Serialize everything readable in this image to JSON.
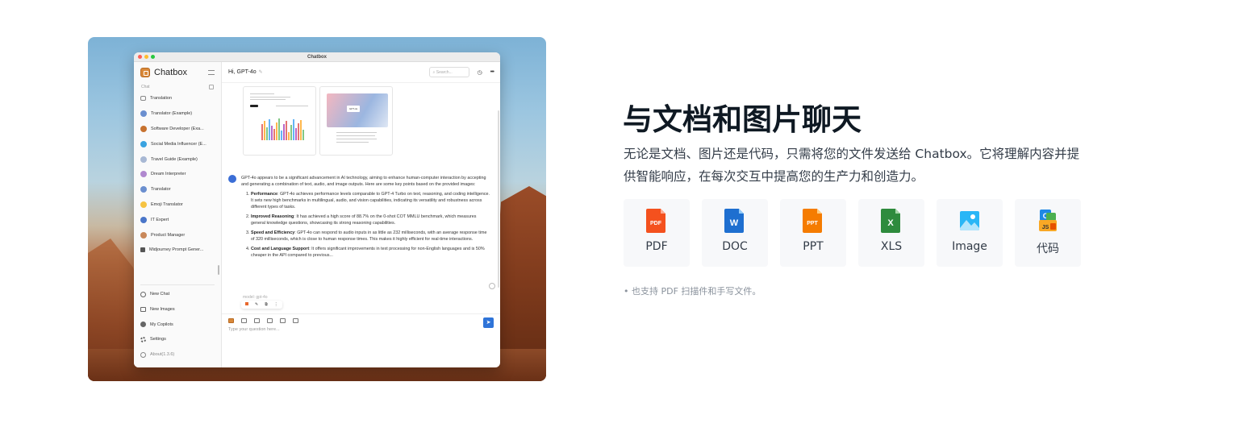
{
  "app": {
    "window_title": "Chatbox",
    "name": "Chatbox",
    "section_label": "Chat",
    "chat_list": [
      "Translation",
      "Translator (Example)",
      "Software Developer (Exa...",
      "Social Media Influencer (E...",
      "Travel Guide (Example)",
      "Dream Interpreter",
      "Translator",
      "Emoji Translator",
      "IT Expert",
      "Product Manager",
      "Midjourney Prompt Gener..."
    ],
    "bottom_nav": [
      "New Chat",
      "New Images",
      "My Copilots",
      "Settings",
      "About(1.3.6)"
    ],
    "chat_title": "Hi, GPT-4o",
    "search_placeholder": "Search...",
    "attachment_slide_label": "GPT-4o",
    "message": {
      "intro": "GPT-4o appears to be a significant advancement in AI technology, aiming to enhance human-computer interaction by accepting and generating a combination of text, audio, and image outputs. Here are some key points based on the provided images:",
      "points": [
        {
          "title": "Performance",
          "text": ": GPT-4o achieves performance levels comparable to GPT-4 Turbo on text, reasoning, and coding intelligence. It sets new high benchmarks in multilingual, audio, and vision capabilities, indicating its versatility and robustness across different types of tasks."
        },
        {
          "title": "Improved Reasoning",
          "text": ": It has achieved a high score of 88.7% on the 0-shot COT MMLU benchmark, which measures general knowledge questions, showcasing its strong reasoning capabilities."
        },
        {
          "title": "Speed and Efficiency",
          "text": ": GPT-4o can respond to audio inputs in as little as 232 milliseconds, with an average response time of 320 milliseconds, which is close to human response times. This makes it highly efficient for real-time interactions."
        },
        {
          "title": "Cost and Language Support",
          "text": ": It offers significant improvements in text processing for non-English languages and is 50% cheaper in the API compared to previous..."
        }
      ],
      "model": "model: gpt-4o"
    },
    "input_placeholder": "Type your question here..."
  },
  "feature": {
    "title": "与文档和图片聊天",
    "description": "无论是文档、图片还是代码，只需将您的文件发送给 Chatbox。它将理解内容并提供智能响应，在每次交互中提高您的生产力和创造力。",
    "formats": [
      {
        "label": "PDF",
        "icon": "pdf-file-icon",
        "color": "#f4511e",
        "badge": "PDF"
      },
      {
        "label": "DOC",
        "icon": "doc-file-icon",
        "color": "#1e6fd0",
        "badge": "W"
      },
      {
        "label": "PPT",
        "icon": "ppt-file-icon",
        "color": "#f57c00",
        "badge": "PPT"
      },
      {
        "label": "XLS",
        "icon": "xls-file-icon",
        "color": "#2e8b3d",
        "badge": "X"
      },
      {
        "label": "Image",
        "icon": "image-file-icon",
        "color": "#29b6f6",
        "badge": ""
      },
      {
        "label": "代码",
        "icon": "code-file-icon",
        "color": "#f9a825",
        "badge": "JS"
      }
    ],
    "footnote": "• 也支持 PDF 扫描件和手写文件。"
  }
}
